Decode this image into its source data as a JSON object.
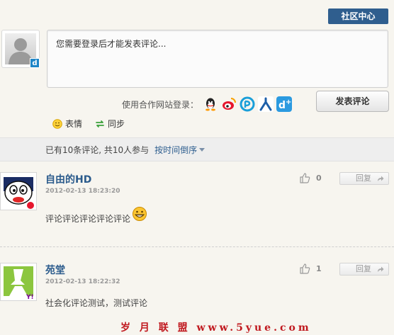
{
  "header": {
    "community_label": "社区中心"
  },
  "composer": {
    "placeholder": "您需要登录后才能发表评论...",
    "login_label": "使用合作网站登录：",
    "partners": [
      "qq-icon",
      "weibo-icon",
      "pengyou-icon",
      "renren-icon",
      "kaixin-icon"
    ],
    "submit_label": "发表评论",
    "emoji_label": "表情",
    "sync_label": "同步"
  },
  "summary": {
    "text": "已有10条评论, 共10人参与",
    "sort_label": "按时间倒序"
  },
  "comments": [
    {
      "name": "自由的HD",
      "time": "2012-02-13 18:23:20",
      "text": "评论评论评论评论评论",
      "likes": "0",
      "reply_label": "回复",
      "source_badge": "weibo-icon"
    },
    {
      "name": "苑堂",
      "time": "2012-02-13 18:22:32",
      "text": "社会化评论测试，测试评论",
      "likes": "1",
      "reply_label": "回复",
      "source_badge": "yahoo-icon"
    }
  ],
  "watermark": "岁 月 联 盟  www.5yue.com",
  "colors": {
    "accent": "#2f5e8e",
    "link": "#2b5b8c",
    "watermark": "#c0181e"
  }
}
